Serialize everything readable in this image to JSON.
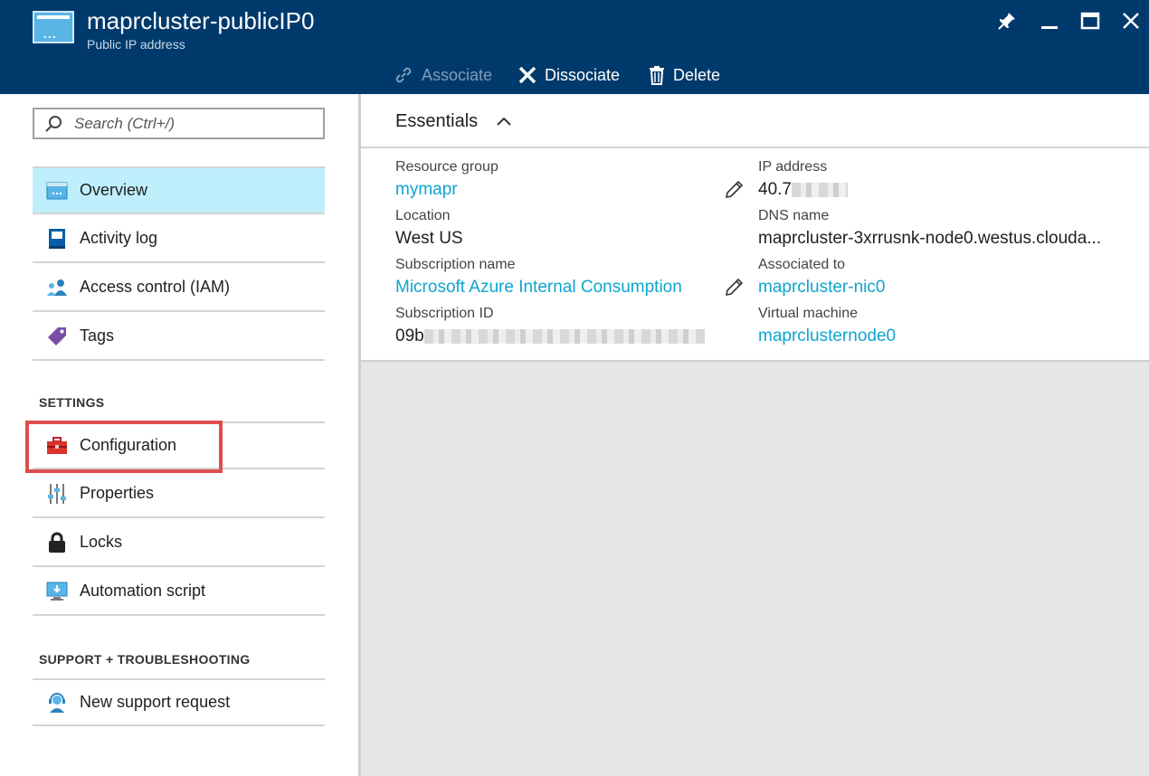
{
  "header": {
    "title": "maprcluster-publicIP0",
    "subtitle": "Public IP address",
    "commands": [
      {
        "label": "Associate",
        "enabled": false
      },
      {
        "label": "Dissociate",
        "enabled": true
      },
      {
        "label": "Delete",
        "enabled": true
      }
    ]
  },
  "search": {
    "placeholder": "Search (Ctrl+/)"
  },
  "menu": {
    "general": [
      {
        "label": "Overview",
        "selected": true,
        "icon": "overview-icon"
      },
      {
        "label": "Activity log",
        "icon": "activity-log-icon"
      },
      {
        "label": "Access control (IAM)",
        "icon": "iam-icon"
      },
      {
        "label": "Tags",
        "icon": "tag-icon"
      }
    ],
    "settings_title": "SETTINGS",
    "settings": [
      {
        "label": "Configuration",
        "icon": "toolbox-icon"
      },
      {
        "label": "Properties",
        "icon": "properties-icon"
      },
      {
        "label": "Locks",
        "icon": "lock-icon"
      },
      {
        "label": "Automation script",
        "icon": "automation-script-icon"
      }
    ],
    "support_title": "SUPPORT + TROUBLESHOOTING",
    "support": [
      {
        "label": "New support request",
        "icon": "support-icon"
      }
    ]
  },
  "essentials": {
    "title": "Essentials",
    "resource_group": {
      "label": "Resource group",
      "value": "mymapr"
    },
    "location": {
      "label": "Location",
      "value": "West US"
    },
    "subscription_name": {
      "label": "Subscription name",
      "value": "Microsoft Azure Internal Consumption"
    },
    "subscription_id": {
      "label": "Subscription ID",
      "value": "09b"
    },
    "ip_address": {
      "label": "IP address",
      "value": "40.7"
    },
    "dns_name": {
      "label": "DNS name",
      "value": "maprcluster-3xrrusnk-node0.westus.clouda..."
    },
    "associated_to": {
      "label": "Associated to",
      "value": "maprcluster-nic0"
    },
    "virtual_machine": {
      "label": "Virtual machine",
      "value": "maprclusternode0"
    }
  },
  "colors": {
    "header_bg": "#003a6c",
    "selected_bg": "#bfeffc",
    "link": "#0ea4cf",
    "highlight": "#e04d4d"
  }
}
